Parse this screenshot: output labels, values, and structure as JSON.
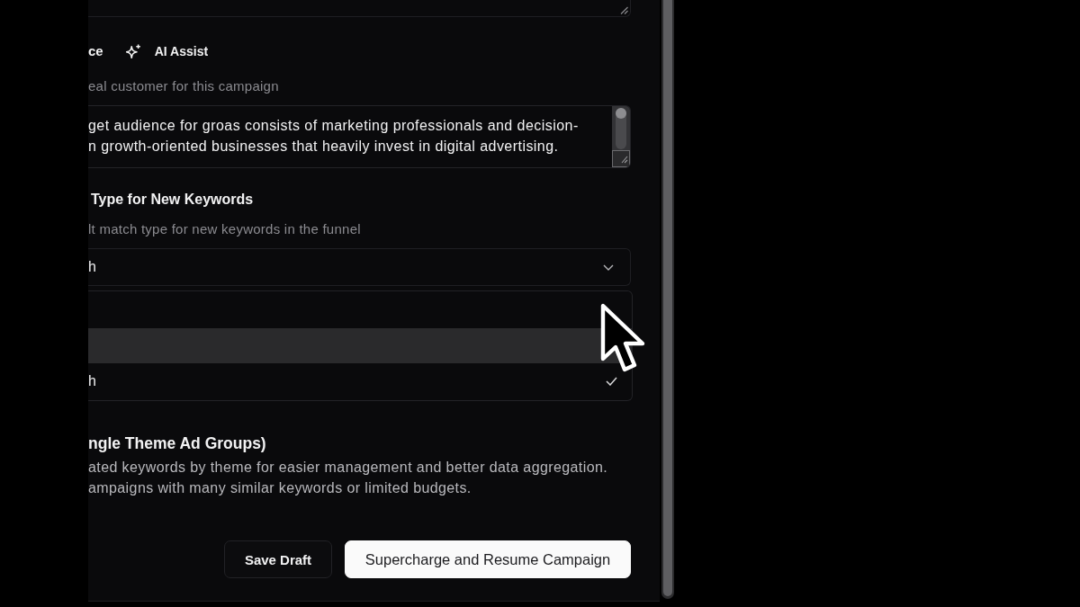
{
  "audience": {
    "label": "ce",
    "assist_button": "AI Assist",
    "hint": "eal customer for this campaign",
    "value": "get audience for groas consists of marketing professionals and decision-\nn growth-oriented businesses that heavily invest in digital advertising."
  },
  "match_type": {
    "label": "Type for New Keywords",
    "hint": "lt match type for new keywords in the funnel",
    "value": "h",
    "expanded": true,
    "options": [
      {
        "highlighted": false,
        "selected": false
      },
      {
        "highlighted": true,
        "selected": false
      },
      {
        "label": "h",
        "highlighted": false,
        "selected": true
      }
    ]
  },
  "grouping": {
    "label": "ngle Theme Ad Groups)",
    "description": "ated keywords by theme for easier management and better data aggregation.\nampaigns with many similar keywords or limited budgets."
  },
  "buttons": [
    {
      "label": "Save Draft",
      "kind": "secondary"
    },
    {
      "label": "Supercharge and Resume Campaign",
      "kind": "primary"
    }
  ]
}
